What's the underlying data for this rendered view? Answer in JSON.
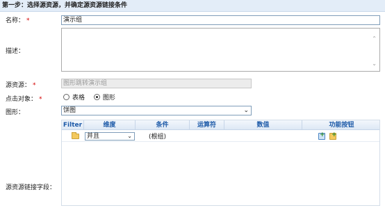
{
  "header": {
    "title": "第一步：选择源资源，并确定源资源链接条件"
  },
  "form": {
    "name": {
      "label": "名称：",
      "required_mark": "*",
      "value": "演示组"
    },
    "description": {
      "label": "描述：",
      "value": ""
    },
    "source": {
      "label": "源资源：",
      "required_mark": "*",
      "value": "图形跳转演示组"
    },
    "click_target": {
      "label": "点击对象：",
      "required_mark": "*",
      "options": [
        {
          "label": "表格",
          "checked": false
        },
        {
          "label": "图形",
          "checked": true
        }
      ]
    },
    "chart": {
      "label": "图形：",
      "selected": "饼图"
    },
    "link_fields": {
      "label": "源资源链接字段："
    }
  },
  "grid": {
    "columns": [
      "Filter",
      "维度",
      "条件",
      "运算符",
      "数值",
      "功能按钮"
    ],
    "row": {
      "logic_selected": "并且",
      "root_text": "(根组)"
    }
  }
}
